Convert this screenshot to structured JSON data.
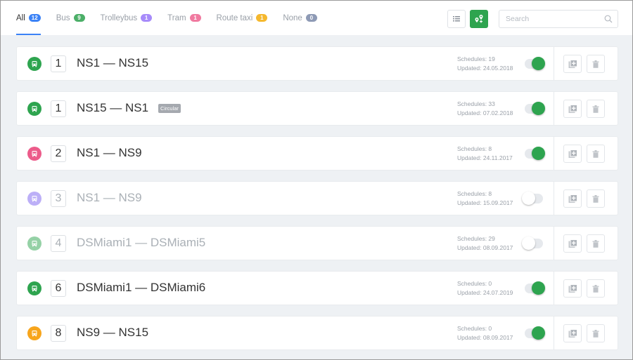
{
  "tabs": [
    {
      "label": "All",
      "count": "12",
      "color": "#3b82f6",
      "active": true
    },
    {
      "label": "Bus",
      "count": "9",
      "color": "#4caf68"
    },
    {
      "label": "Trolleybus",
      "count": "1",
      "color": "#a78bfa"
    },
    {
      "label": "Tram",
      "count": "1",
      "color": "#f07aa0"
    },
    {
      "label": "Route taxi",
      "count": "1",
      "color": "#f5b82e"
    },
    {
      "label": "None",
      "count": "0",
      "color": "#8e9ab5"
    }
  ],
  "search": {
    "placeholder": "Search",
    "value": ""
  },
  "colors": {
    "accent": "#2ea44f",
    "bus": "#2ea44f",
    "tram": "#ec5b8a",
    "trolleybus": "#b8a8f5",
    "taxi": "#f7a51c",
    "bus_light": "#9bd3ab"
  },
  "routes": [
    {
      "number": "1",
      "title": "NS1 — NS15",
      "schedules": "Schedules: 19",
      "updated": "Updated: 24.05.2018",
      "enabled": true,
      "icon": "bus-icon",
      "color": "#2ea44f"
    },
    {
      "number": "1",
      "title": "NS15 — NS1",
      "badge": "Circular",
      "schedules": "Schedules: 33",
      "updated": "Updated: 07.02.2018",
      "enabled": true,
      "icon": "bus-icon",
      "color": "#2ea44f"
    },
    {
      "number": "2",
      "title": "NS1 — NS9",
      "schedules": "Schedules: 8",
      "updated": "Updated: 24.11.2017",
      "enabled": true,
      "icon": "tram-icon",
      "color": "#ec5b8a"
    },
    {
      "number": "3",
      "title": "NS1 — NS9",
      "schedules": "Schedules: 8",
      "updated": "Updated: 15.09.2017",
      "enabled": false,
      "icon": "trolleybus-icon",
      "color": "#7c62f0"
    },
    {
      "number": "4",
      "title": "DSMiami1 — DSMiami5",
      "schedules": "Schedules: 29",
      "updated": "Updated: 08.09.2017",
      "enabled": false,
      "icon": "bus-icon",
      "color": "#2ea44f"
    },
    {
      "number": "6",
      "title": "DSMiami1 — DSMiami6",
      "schedules": "Schedules: 0",
      "updated": "Updated: 24.07.2019",
      "enabled": true,
      "icon": "bus-icon",
      "color": "#2ea44f"
    },
    {
      "number": "8",
      "title": "NS9 — NS15",
      "schedules": "Schedules: 0",
      "updated": "Updated: 08.09.2017",
      "enabled": true,
      "icon": "route-taxi-icon",
      "color": "#f7a51c"
    }
  ]
}
